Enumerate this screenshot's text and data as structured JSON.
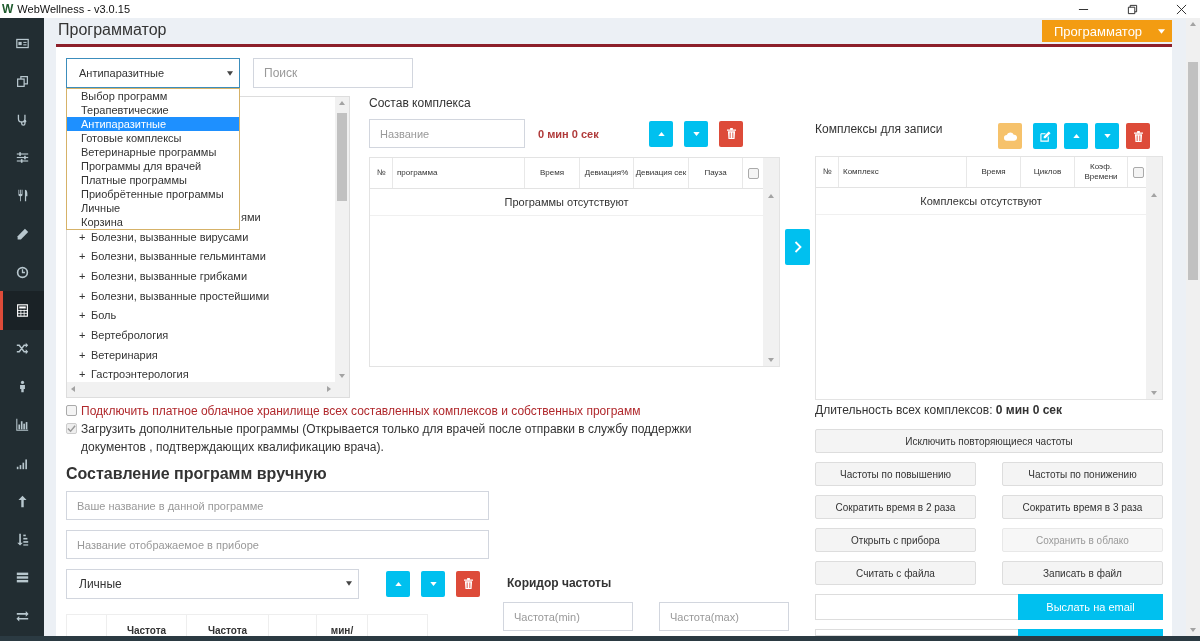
{
  "window": {
    "logo": "W",
    "title": "WebWellness - v3.0.15"
  },
  "sidebar": {
    "items": [
      {
        "selected": false
      },
      {
        "selected": false
      },
      {
        "selected": false
      },
      {
        "selected": false
      },
      {
        "selected": false
      },
      {
        "selected": false
      },
      {
        "selected": false
      },
      {
        "selected": true
      },
      {
        "selected": false
      },
      {
        "selected": false
      },
      {
        "selected": false
      },
      {
        "selected": false
      },
      {
        "selected": false
      },
      {
        "selected": false
      },
      {
        "selected": false
      },
      {
        "selected": false
      }
    ]
  },
  "header": {
    "title": "Программатор",
    "mode_button": "Программатор"
  },
  "program_filter": {
    "value": "Антипаразитные",
    "search_placeholder": "Поиск",
    "expanded": true,
    "options": [
      {
        "label": "Выбор программ",
        "selected": false
      },
      {
        "label": "Терапевтические",
        "selected": false
      },
      {
        "label": "Антипаразитные",
        "selected": true
      },
      {
        "label": "Готовые комплексы",
        "selected": false
      },
      {
        "label": "Ветеринарные программы",
        "selected": false
      },
      {
        "label": "Программы для врачей",
        "selected": false
      },
      {
        "label": "Платные программы",
        "selected": false
      },
      {
        "label": "Приобрётенные программы",
        "selected": false
      },
      {
        "label": "Личные",
        "selected": false
      },
      {
        "label": "Корзина",
        "selected": false
      }
    ]
  },
  "tree": {
    "items": [
      {
        "kind": "fragment",
        "label": "ями"
      },
      {
        "kind": "group",
        "expander": "+",
        "label": "Болезни, вызванные вирусами"
      },
      {
        "kind": "group",
        "expander": "+",
        "label": "Болезни, вызванные гельминтами"
      },
      {
        "kind": "group",
        "expander": "+",
        "label": "Болезни, вызванные грибками"
      },
      {
        "kind": "group",
        "expander": "+",
        "label": "Болезни, вызванные простейшими"
      },
      {
        "kind": "group",
        "expander": "+",
        "label": "Боль"
      },
      {
        "kind": "group",
        "expander": "+",
        "label": "Вертебрология"
      },
      {
        "kind": "group",
        "expander": "+",
        "label": "Ветеринария"
      },
      {
        "kind": "group",
        "expander": "+",
        "label": "Гастроэнтерология"
      }
    ]
  },
  "complex": {
    "title": "Состав комплекса",
    "name_placeholder": "Название",
    "duration": "0 мин 0 сек",
    "select_all_checked": false,
    "columns": [
      {
        "label": "№"
      },
      {
        "label": "программа"
      },
      {
        "label": "Время"
      },
      {
        "label": "Девиация%"
      },
      {
        "label": "Девиация сек"
      },
      {
        "label": "Пауза"
      }
    ],
    "empty_message": "Программы отсутствуют"
  },
  "options": [
    {
      "kind": "warning",
      "label": "Подключить платное облачное хранилище всех составленных комплексов и собственных программ",
      "checked": false,
      "disabled": false
    },
    {
      "kind": "normal",
      "label": "Загрузить дополнительные программы (Открывается только для врачей после отправки в службу поддержки документов , подтверждающих квалификацию врача).",
      "checked": true,
      "disabled": true
    }
  ],
  "manual": {
    "title": "Составление программ вручную",
    "name_placeholder": "Ваше название в данной программе",
    "device_name_placeholder": "Название отображаемое в приборе",
    "category": "Личные",
    "columns": [
      {
        "kind": "blank"
      },
      {
        "kind": "text",
        "label": "Частота"
      },
      {
        "kind": "text",
        "label": "Частота"
      },
      {
        "kind": "blank"
      },
      {
        "kind": "text",
        "label": "мин/"
      },
      {
        "kind": "blank"
      }
    ]
  },
  "frequency_range": {
    "title": "Коридор частоты",
    "min_placeholder": "Частота(min)",
    "max_placeholder": "Частота(max)"
  },
  "records": {
    "title": "Комплексы для записи",
    "select_all_checked": false,
    "columns": [
      {
        "label": "№"
      },
      {
        "label": "Комплекс"
      },
      {
        "label": "Время"
      },
      {
        "label": "Циклов"
      },
      {
        "label": "Коэф. Времени"
      }
    ],
    "empty_message": "Комплексы отсутствуют",
    "total": "Длительность всех комплексов: **0 мин 0 сек**"
  },
  "actions": [
    {
      "label": "Исключить повторяющиеся частоты",
      "kind": "wide",
      "disabled": false
    },
    {
      "label": "Частоты по повышению",
      "kind": "half",
      "disabled": false
    },
    {
      "label": "Частоты по понижению",
      "kind": "half",
      "disabled": false
    },
    {
      "label": "Сократить время в 2 раза",
      "kind": "half",
      "disabled": false
    },
    {
      "label": "Сократить время в 3 раза",
      "kind": "half",
      "disabled": false
    },
    {
      "label": "Открыть с прибора",
      "kind": "half",
      "disabled": false
    },
    {
      "label": "Сохранить в облако",
      "kind": "half",
      "disabled": true
    },
    {
      "label": "Считать с файла",
      "kind": "half",
      "disabled": false
    },
    {
      "label": "Записать в файл",
      "kind": "half",
      "disabled": false
    }
  ],
  "email": {
    "button": "Выслать на email"
  }
}
